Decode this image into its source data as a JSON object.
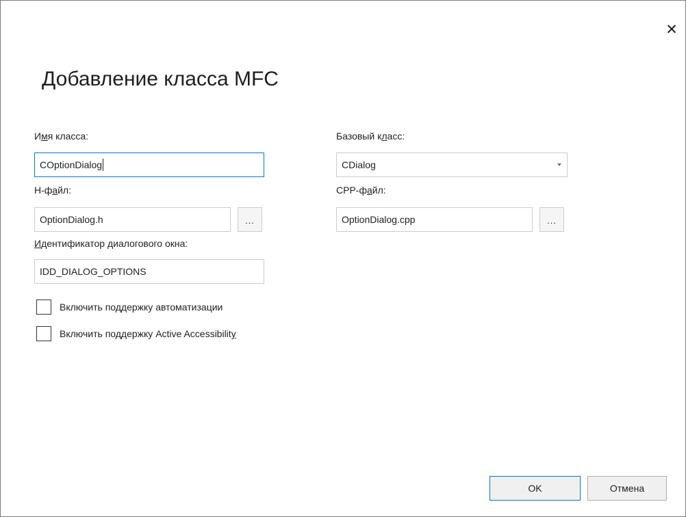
{
  "dialog": {
    "title": "Добавление класса MFC",
    "close_glyph": "✕"
  },
  "fields": {
    "class_name": {
      "label_pre": "И",
      "label_acc": "м",
      "label_post": "я класса:",
      "value": "COptionDialog"
    },
    "base_class": {
      "label_pre": "Базовый к",
      "label_acc": "л",
      "label_post": "асс:",
      "value": "CDialog"
    },
    "h_file": {
      "label_pre": "H-ф",
      "label_acc": "а",
      "label_post": "йл:",
      "value": "OptionDialog.h",
      "browse_label": "..."
    },
    "cpp_file": {
      "label_pre": "CPP-ф",
      "label_acc": "а",
      "label_post": "йл:",
      "value": "OptionDialog.cpp",
      "browse_label": "..."
    },
    "dialog_id": {
      "label_pre": "",
      "label_acc": "И",
      "label_post": "дентификатор диалогового окна:",
      "value": "IDD_DIALOG_OPTIONS"
    }
  },
  "checkboxes": [
    {
      "label_pre": "Включить поддержку автоматизации",
      "label_acc": "",
      "label_post": "",
      "checked": false
    },
    {
      "label_pre": "Включить поддержку Active Accessibilit",
      "label_acc": "y",
      "label_post": "",
      "checked": false
    }
  ],
  "buttons": {
    "ok": "OK",
    "cancel": "Отмена"
  },
  "colors": {
    "focus_border": "#0078d7",
    "input_border": "#cccccc"
  }
}
